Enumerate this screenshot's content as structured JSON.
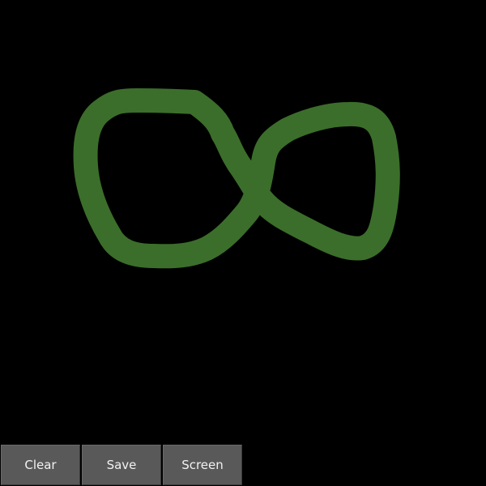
{
  "canvas": {
    "background_color": "#000000",
    "stroke_color": "#3b6e2a",
    "drawing": "infinity-like freehand loop"
  },
  "toolbar": {
    "buttons": [
      {
        "id": "clear",
        "label": "Clear"
      },
      {
        "id": "save",
        "label": "Save"
      },
      {
        "id": "screen",
        "label": "Screen"
      }
    ],
    "button_color": "#595959",
    "text_color": "#f2f2f2"
  }
}
